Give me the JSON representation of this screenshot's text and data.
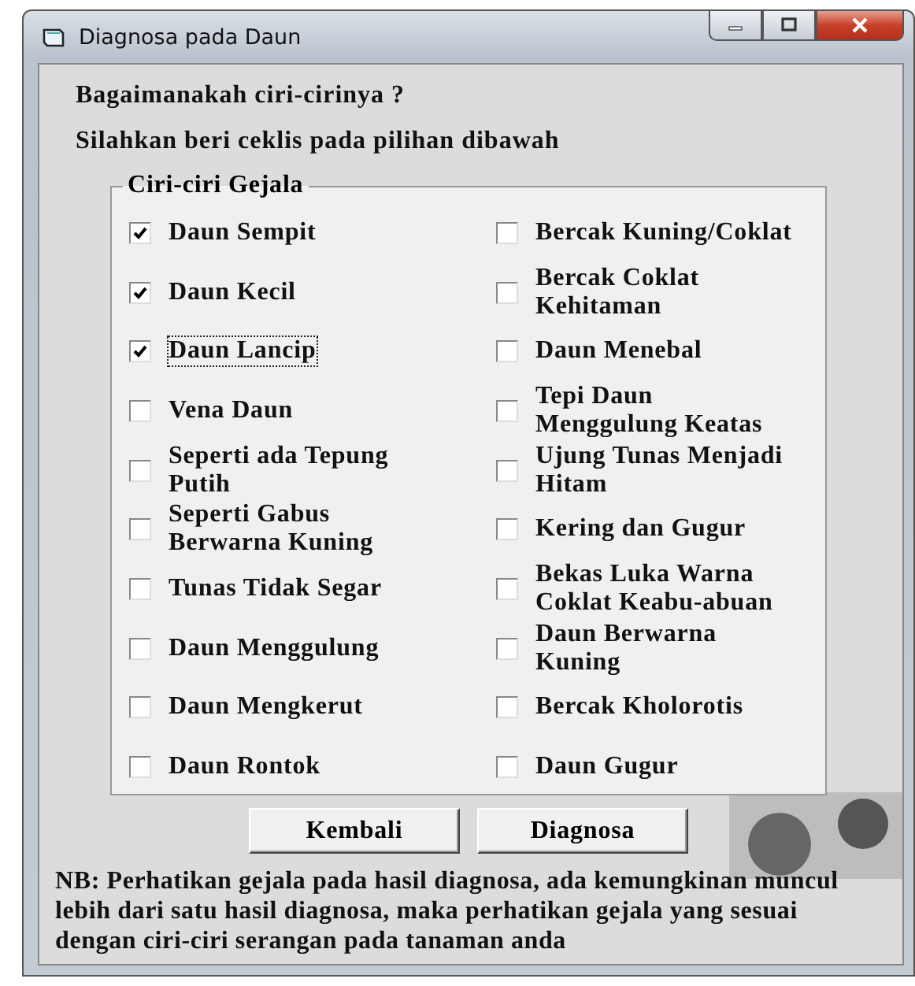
{
  "window": {
    "title": "Diagnosa pada Daun"
  },
  "question": "Bagaimanakah ciri-cirinya ?",
  "instruction": "Silahkan beri ceklis pada pilihan dibawah",
  "group": {
    "title": "Ciri-ciri Gejala",
    "options": [
      {
        "label": "Daun Sempit",
        "checked": true,
        "focused": false
      },
      {
        "label": "Daun Kecil",
        "checked": true,
        "focused": false
      },
      {
        "label": "Daun Lancip",
        "checked": true,
        "focused": true
      },
      {
        "label": "Vena Daun",
        "checked": false,
        "focused": false
      },
      {
        "label": "Seperti ada Tepung Putih",
        "checked": false,
        "focused": false
      },
      {
        "label": "Seperti Gabus Berwarna Kuning",
        "checked": false,
        "focused": false
      },
      {
        "label": "Tunas Tidak Segar",
        "checked": false,
        "focused": false
      },
      {
        "label": "Daun Menggulung",
        "checked": false,
        "focused": false
      },
      {
        "label": "Daun Mengkerut",
        "checked": false,
        "focused": false
      },
      {
        "label": "Daun Rontok",
        "checked": false,
        "focused": false
      },
      {
        "label": "Bercak Kuning/Coklat",
        "checked": false,
        "focused": false
      },
      {
        "label": "Bercak Coklat Kehitaman",
        "checked": false,
        "focused": false
      },
      {
        "label": "Daun Menebal",
        "checked": false,
        "focused": false
      },
      {
        "label": "Tepi Daun Menggulung Keatas",
        "checked": false,
        "focused": false
      },
      {
        "label": "Ujung Tunas Menjadi Hitam",
        "checked": false,
        "focused": false
      },
      {
        "label": "Kering dan Gugur",
        "checked": false,
        "focused": false
      },
      {
        "label": "Bekas Luka Warna Coklat Keabu-abuan",
        "checked": false,
        "focused": false
      },
      {
        "label": "Daun Berwarna Kuning",
        "checked": false,
        "focused": false
      },
      {
        "label": "Bercak Kholorotis",
        "checked": false,
        "focused": false
      },
      {
        "label": "Daun Gugur",
        "checked": false,
        "focused": false
      }
    ]
  },
  "buttons": [
    "Kembali",
    "Diagnosa"
  ],
  "note": "NB: Perhatikan gejala pada hasil diagnosa,  ada kemungkinan muncul lebih dari satu hasil diagnosa, maka perhatikan gejala yang sesuai dengan ciri-ciri serangan pada tanaman anda"
}
